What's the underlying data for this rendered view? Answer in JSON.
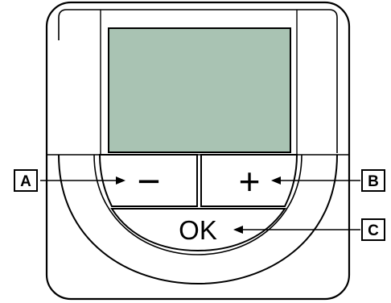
{
  "device": {
    "screen_color": "#a9c3b3",
    "outline_color": "#000000",
    "background_color": "#ffffff",
    "buttons": {
      "minus": {
        "label": "−"
      },
      "plus": {
        "label": "+"
      },
      "ok": {
        "label": "OK"
      }
    }
  },
  "callouts": {
    "a": "A",
    "b": "B",
    "c": "C"
  }
}
